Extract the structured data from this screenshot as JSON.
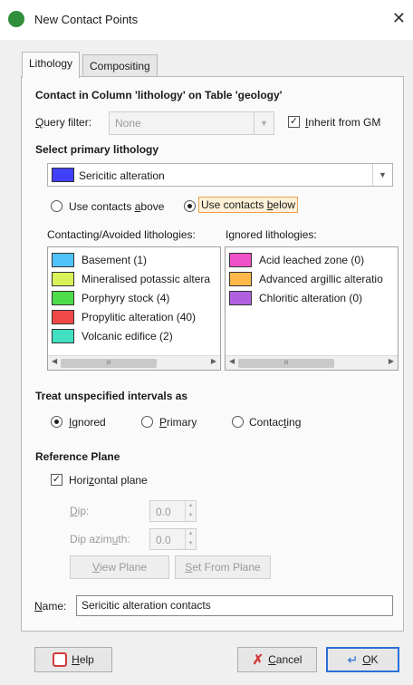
{
  "window": {
    "title": "New Contact Points",
    "close_glyph": "✕"
  },
  "tabs": [
    {
      "label": "Lithology",
      "active": true
    },
    {
      "label": "Compositing",
      "active": false
    }
  ],
  "contact_heading": "Contact in Column 'lithology' on Table 'geology'",
  "query_filter": {
    "label": "Query filter:",
    "value": "None",
    "inherit_label": "Inherit from GM",
    "inherit_checked": true
  },
  "primary": {
    "heading": "Select primary lithology",
    "selected": "Sericitic alteration",
    "selected_color": "#4040ff"
  },
  "contacts": {
    "above_label": "Use contacts above",
    "below_label": "Use contacts below",
    "selected": "below"
  },
  "lists": {
    "contacting_heading": "Contacting/Avoided lithologies:",
    "ignored_heading": "Ignored lithologies:",
    "contacting": [
      {
        "label": "Basement (1)",
        "color": "#4fc3f7"
      },
      {
        "label": "Mineralised potassic altera",
        "color": "#d8f25a"
      },
      {
        "label": "Porphyry stock (4)",
        "color": "#4cdc4c"
      },
      {
        "label": "Propylitic alteration (40)",
        "color": "#f04848"
      },
      {
        "label": "Volcanic edifice (2)",
        "color": "#40e0c0"
      }
    ],
    "ignored": [
      {
        "label": "Acid leached zone (0)",
        "color": "#f050c8"
      },
      {
        "label": "Advanced argillic alteratio",
        "color": "#ffb84a"
      },
      {
        "label": "Chloritic alteration (0)",
        "color": "#b060e0"
      }
    ],
    "scroll_glyph": "III"
  },
  "unspecified": {
    "heading": "Treat unspecified intervals as",
    "options": [
      "Ignored",
      "Primary",
      "Contacting"
    ],
    "selected": "Ignored"
  },
  "reference_plane": {
    "heading": "Reference Plane",
    "horizontal_label": "Horizontal plane",
    "horizontal_checked": true,
    "dip_label": "Dip:",
    "dip_value": "0.0",
    "dip_azimuth_label": "Dip azimuth:",
    "dip_azimuth_value": "0.0",
    "view_plane_label": "View Plane",
    "set_from_plane_label": "Set From Plane"
  },
  "name": {
    "label": "Name:",
    "value": "Sericitic alteration contacts"
  },
  "footer": {
    "help_label": "Help",
    "cancel_label": "Cancel",
    "ok_label": "OK"
  }
}
